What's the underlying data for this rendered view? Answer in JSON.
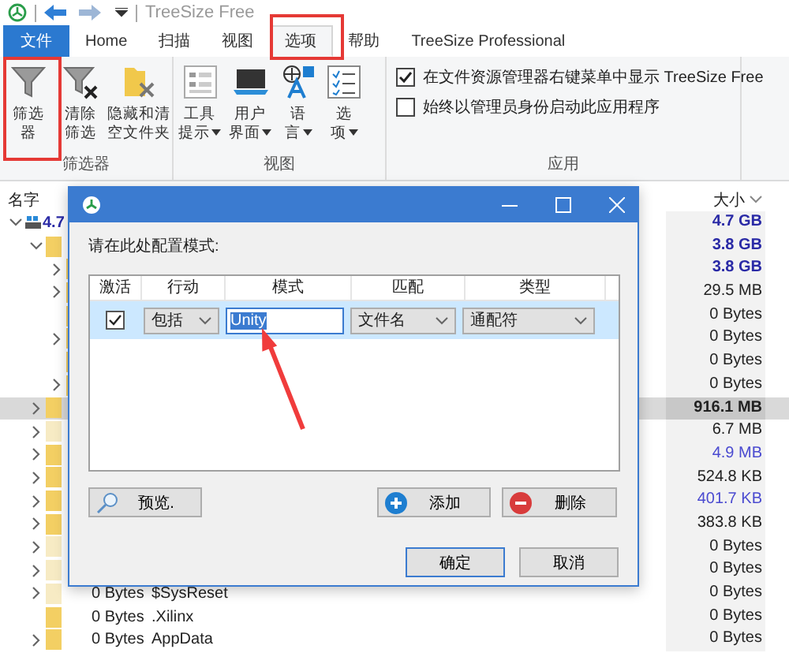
{
  "app": {
    "title": "TreeSize Free"
  },
  "tabs": [
    {
      "label": "文件",
      "kind": "file",
      "selected": false
    },
    {
      "label": "Home",
      "kind": "tab",
      "selected": false
    },
    {
      "label": "扫描",
      "kind": "tab",
      "selected": false
    },
    {
      "label": "视图",
      "kind": "tab",
      "selected": false
    },
    {
      "label": "选项",
      "kind": "tab",
      "selected": true
    },
    {
      "label": "帮助",
      "kind": "tab",
      "selected": false
    },
    {
      "label": "TreeSize Professional",
      "kind": "tab",
      "selected": false
    }
  ],
  "ribbon": {
    "groups": [
      {
        "label": "筛选器",
        "buttons": [
          {
            "lines": [
              "筛选",
              "器"
            ],
            "kind": "filter",
            "dropdown": false
          },
          {
            "lines": [
              "清除",
              "筛选"
            ],
            "kind": "clear",
            "dropdown": false
          },
          {
            "lines": [
              "隐藏和清",
              "空文件夹"
            ],
            "kind": "hide",
            "dropdown": false
          }
        ]
      },
      {
        "label": "视图",
        "buttons": [
          {
            "lines": [
              "工具",
              "提示"
            ],
            "kind": "tooltip",
            "dropdown": true
          },
          {
            "lines": [
              "用户",
              "界面"
            ],
            "kind": "screen",
            "dropdown": true
          },
          {
            "lines": [
              "语",
              "言"
            ],
            "kind": "language",
            "dropdown": true
          },
          {
            "lines": [
              "选",
              "项"
            ],
            "kind": "options",
            "dropdown": true
          }
        ]
      },
      {
        "label": "应用",
        "checkboxes": [
          {
            "label": "在文件资源管理器右键菜单中显示 TreeSize Free",
            "checked": true
          },
          {
            "label": "始终以管理员身份启动此应用程序",
            "checked": false
          }
        ]
      }
    ]
  },
  "tree": {
    "columns": {
      "name": "名字",
      "size": "大小"
    },
    "rows": [
      {
        "kind": "drive",
        "label": "4.7",
        "size": "4.7 GB",
        "bold": true,
        "color": "#2a2aa6",
        "expanded": true,
        "selected": false,
        "children": [
          {
            "kind": "folder",
            "size": "3.8 GB",
            "bold": true,
            "color": "#2a2aa6",
            "hidden": false,
            "expanded": true,
            "selected": false,
            "children": [
              {
                "kind": "folder",
                "size": "3.8 GB",
                "bold": true,
                "color": "#2a2aa6",
                "hidden": false,
                "expanded": false,
                "selected": false
              },
              {
                "kind": "folder",
                "size": "29.5 MB",
                "bold": false,
                "color": "#222222",
                "hidden": false,
                "expanded": false,
                "selected": false
              },
              {
                "kind": "folder",
                "size": "0 Bytes",
                "bold": false,
                "color": "#222222",
                "hidden": false,
                "selected": false
              },
              {
                "kind": "folder",
                "size": "0 Bytes",
                "bold": false,
                "color": "#222222",
                "hidden": false,
                "expanded": false,
                "selected": false
              },
              {
                "kind": "folder",
                "size": "0 Bytes",
                "bold": false,
                "color": "#222222",
                "hidden": false,
                "selected": false
              },
              {
                "kind": "folder",
                "size": "0 Bytes",
                "bold": false,
                "color": "#222222",
                "hidden": false,
                "expanded": false,
                "selected": false
              }
            ]
          },
          {
            "kind": "folder",
            "size": "916.1 MB",
            "bold": true,
            "color": "#222222",
            "hidden": false,
            "expanded": false,
            "selected": true
          },
          {
            "kind": "folder",
            "size": "6.7 MB",
            "bold": false,
            "color": "#222222",
            "hidden": true,
            "expanded": false,
            "selected": false
          },
          {
            "kind": "folder",
            "size": "4.9 MB",
            "bold": false,
            "color": "#4a4ad0",
            "hidden": false,
            "expanded": false,
            "selected": false
          },
          {
            "kind": "folder",
            "size": "524.8 KB",
            "bold": false,
            "color": "#222222",
            "hidden": false,
            "expanded": false,
            "selected": false
          },
          {
            "kind": "folder",
            "size": "401.7 KB",
            "bold": false,
            "color": "#4a4ad0",
            "hidden": false,
            "expanded": false,
            "selected": false
          },
          {
            "kind": "folder",
            "size": "383.8 KB",
            "bold": false,
            "color": "#222222",
            "hidden": false,
            "expanded": false,
            "selected": false
          },
          {
            "kind": "folder",
            "size": "0 Bytes",
            "bold": false,
            "color": "#222222",
            "hidden": true,
            "expanded": false,
            "selected": false
          },
          {
            "kind": "folder",
            "size": "0 Bytes",
            "bold": false,
            "color": "#222222",
            "hidden": true,
            "expanded": false,
            "selected": false
          },
          {
            "kind": "folder",
            "tree_size": "0 Bytes",
            "name": "$SysReset",
            "size": "0 Bytes",
            "bold": false,
            "color": "#222222",
            "hidden": true,
            "expanded": false,
            "selected": false
          },
          {
            "kind": "folder",
            "tree_size": "0 Bytes",
            "name": ".Xilinx",
            "size": "0 Bytes",
            "bold": false,
            "color": "#222222",
            "hidden": false,
            "selected": false
          },
          {
            "kind": "folder",
            "tree_size": "0 Bytes",
            "name": "AppData",
            "size": "0 Bytes",
            "bold": false,
            "color": "#222222",
            "hidden": false,
            "expanded": false,
            "selected": false
          }
        ]
      }
    ]
  },
  "dialog": {
    "prompt": "请在此处配置模式:",
    "columns": [
      "激活",
      "行动",
      "模式",
      "匹配",
      "类型"
    ],
    "rows": [
      {
        "active": true,
        "action": "包括",
        "pattern": "Unity",
        "pattern_selected": true,
        "match": "文件名",
        "type": "通配符",
        "selected": true
      }
    ],
    "buttons": [
      {
        "label": "预览.",
        "kind": "preview"
      },
      {
        "label": "添加",
        "kind": "add"
      },
      {
        "label": "删除",
        "kind": "delete"
      }
    ],
    "footer_buttons": [
      {
        "label": "确定",
        "default": true
      },
      {
        "label": "取消",
        "default": false
      }
    ]
  }
}
